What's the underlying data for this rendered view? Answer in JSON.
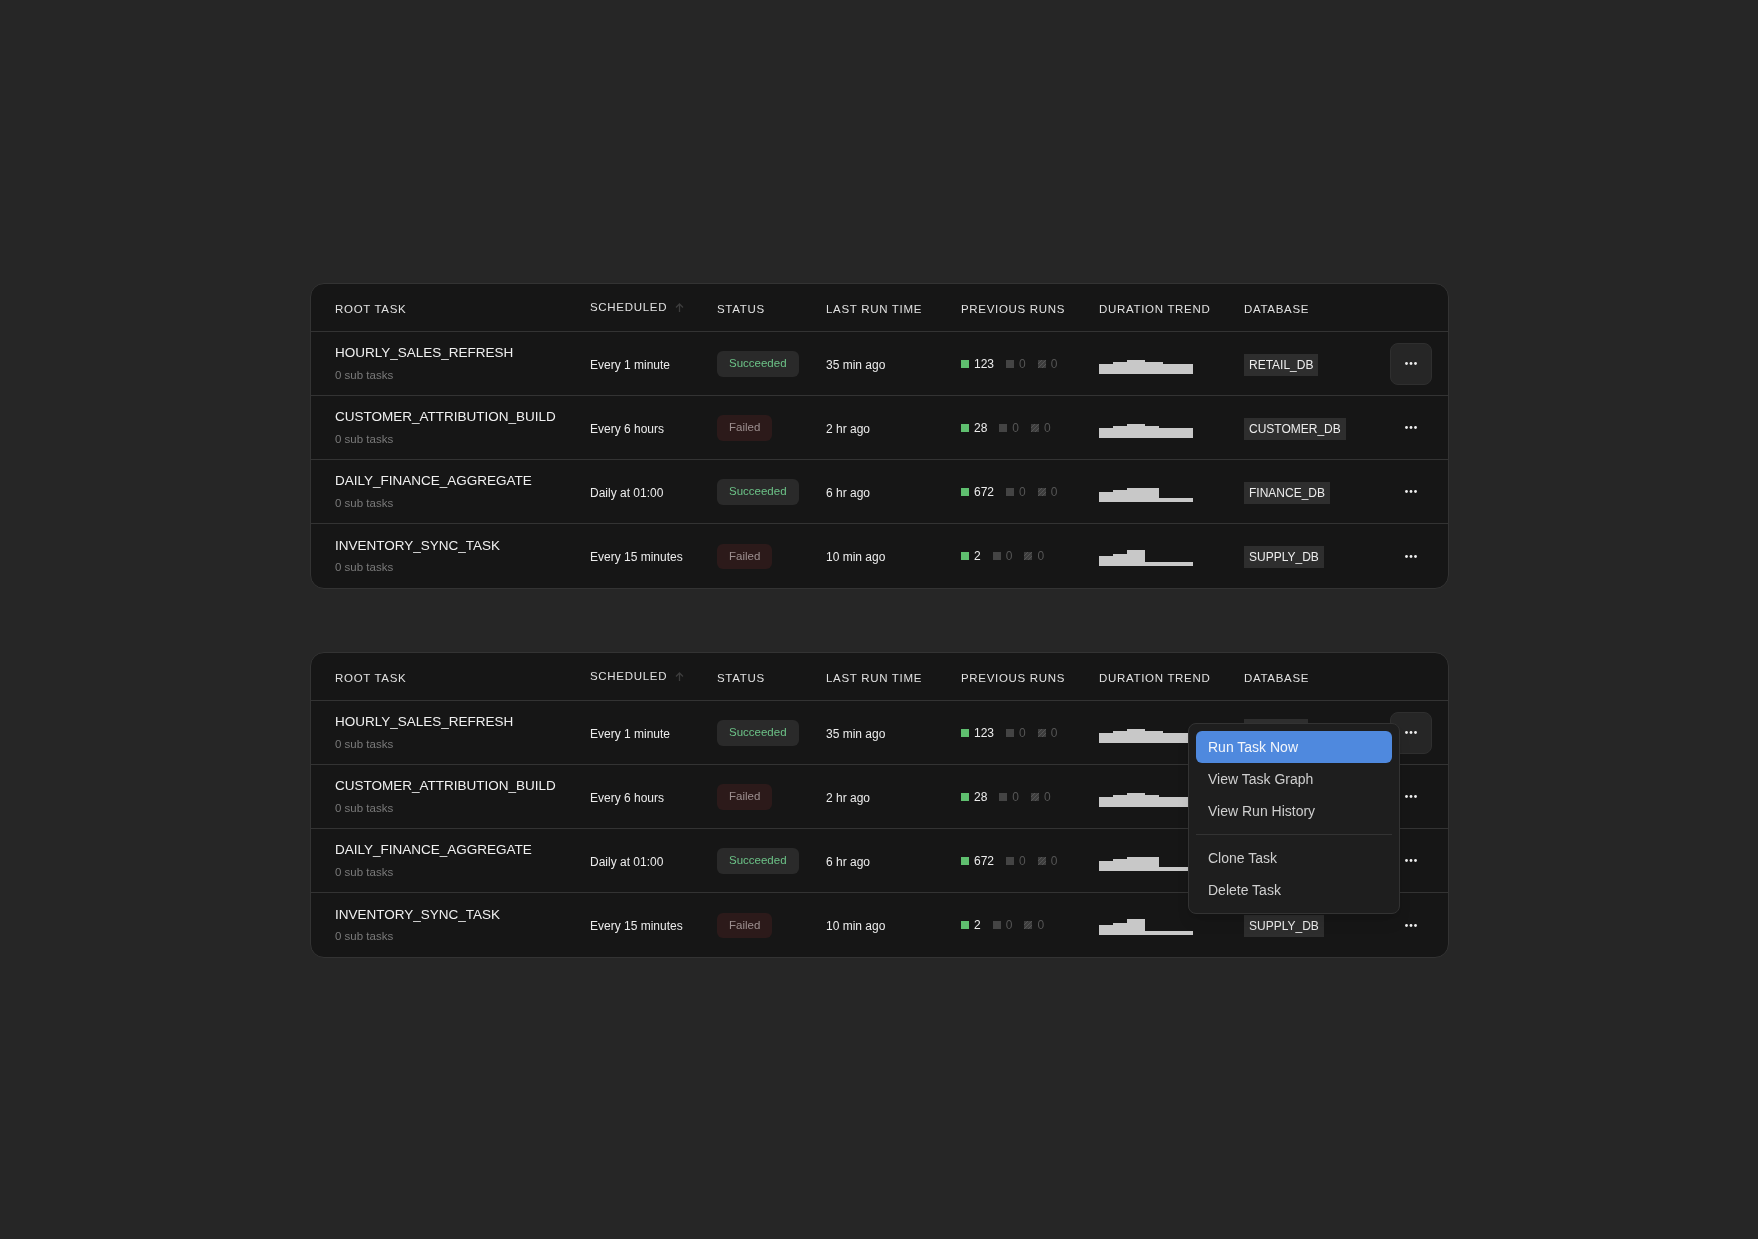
{
  "tables": [
    {
      "columns": [
        {
          "label": "ROOT TASK",
          "sorted": false
        },
        {
          "label": "SCHEDULED",
          "sorted": true
        },
        {
          "label": "STATUS",
          "sorted": false
        },
        {
          "label": "LAST RUN TIME",
          "sorted": false
        },
        {
          "label": "PREVIOUS RUNS",
          "sorted": false
        },
        {
          "label": "DURATION TREND",
          "sorted": false
        },
        {
          "label": "DATABASE",
          "sorted": false
        }
      ],
      "rows": [
        {
          "name": "HOURLY_SALES_REFRESH",
          "sub": "0 sub tasks",
          "schedule": "Every 1 minute",
          "status": {
            "label": "Succeeded",
            "kind": "success"
          },
          "last_run": "35 min ago",
          "runs": [
            "123",
            "0",
            "0"
          ],
          "database": "RETAIL_DB",
          "actions_active": true
        },
        {
          "name": "CUSTOMER_ATTRIBUTION_BUILD",
          "sub": "0 sub tasks",
          "schedule": "Every 6 hours",
          "status": {
            "label": "Failed",
            "kind": "failed"
          },
          "last_run": "2 hr ago",
          "runs": [
            "28",
            "0",
            "0"
          ],
          "database": "CUSTOMER_DB",
          "actions_active": false
        },
        {
          "name": "DAILY_FINANCE_AGGREGATE",
          "sub": "0 sub tasks",
          "schedule": "Daily at 01:00",
          "status": {
            "label": "Succeeded",
            "kind": "success"
          },
          "last_run": "6 hr ago",
          "runs": [
            "672",
            "0",
            "0"
          ],
          "database": "FINANCE_DB",
          "actions_active": false
        },
        {
          "name": "INVENTORY_SYNC_TASK",
          "sub": "0 sub tasks",
          "schedule": "Every 15 minutes",
          "status": {
            "label": "Failed",
            "kind": "failed"
          },
          "last_run": "10 min ago",
          "runs": [
            "2",
            "0",
            "0"
          ],
          "database": "SUPPLY_DB",
          "actions_active": false
        }
      ]
    },
    {
      "columns": [
        {
          "label": "ROOT TASK",
          "sorted": false
        },
        {
          "label": "SCHEDULED",
          "sorted": true
        },
        {
          "label": "STATUS",
          "sorted": false
        },
        {
          "label": "LAST RUN TIME",
          "sorted": false
        },
        {
          "label": "PREVIOUS RUNS",
          "sorted": false
        },
        {
          "label": "DURATION TREND",
          "sorted": false
        },
        {
          "label": "DATABASE",
          "sorted": false
        }
      ],
      "rows": [
        {
          "name": "HOURLY_SALES_REFRESH",
          "sub": "0 sub tasks",
          "schedule": "Every 1 minute",
          "status": {
            "label": "Succeeded",
            "kind": "success"
          },
          "last_run": "35 min ago",
          "runs": [
            "123",
            "0",
            "0"
          ],
          "actions_active": true
        },
        {
          "name": "CUSTOMER_ATTRIBUTION_BUILD",
          "sub": "0 sub tasks",
          "schedule": "Every 6 hours",
          "status": {
            "label": "Failed",
            "kind": "failed"
          },
          "last_run": "2 hr ago",
          "runs": [
            "28",
            "0",
            "0"
          ],
          "actions_active": false
        },
        {
          "name": "DAILY_FINANCE_AGGREGATE",
          "sub": "0 sub tasks",
          "schedule": "Daily at 01:00",
          "status": {
            "label": "Succeeded",
            "kind": "success"
          },
          "last_run": "6 hr ago",
          "runs": [
            "672",
            "0",
            "0"
          ],
          "actions_active": false
        },
        {
          "name": "INVENTORY_SYNC_TASK",
          "sub": "0 sub tasks",
          "schedule": "Every 15 minutes",
          "status": {
            "label": "Failed",
            "kind": "failed"
          },
          "last_run": "10 min ago",
          "runs": [
            "2",
            "0",
            "0"
          ],
          "database": "SUPPLY_DB",
          "actions_active": false
        }
      ],
      "menu": {
        "items": [
          {
            "label": "Run Task Now",
            "selected": true
          },
          {
            "label": "View Task Graph",
            "selected": false
          },
          {
            "label": "View Run History",
            "selected": false
          },
          {
            "label": "Clone Task",
            "selected": false,
            "divider_before": true
          },
          {
            "label": "Delete Task",
            "selected": false
          }
        ]
      }
    }
  ]
}
